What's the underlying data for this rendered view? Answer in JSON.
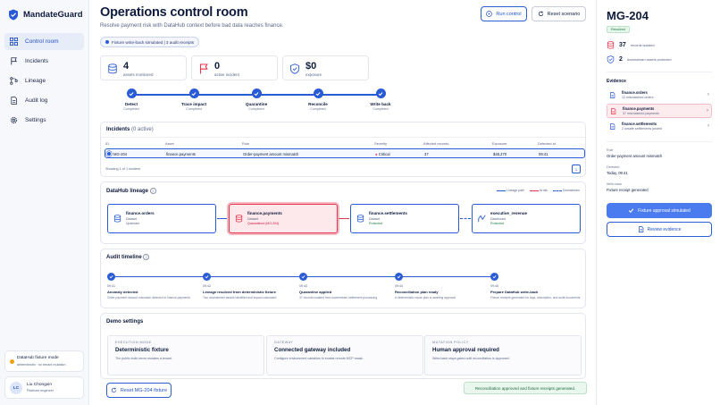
{
  "app": {
    "name": "MandateGuard"
  },
  "sidebar": {
    "items": [
      {
        "label": "Control room",
        "icon": "grid-icon"
      },
      {
        "label": "Incidents",
        "icon": "flag-icon"
      },
      {
        "label": "Lineage",
        "icon": "branch-icon"
      },
      {
        "label": "Audit log",
        "icon": "document-icon"
      },
      {
        "label": "Settings",
        "icon": "gear-icon"
      }
    ],
    "mode_card": {
      "title": "DataHub fixture mode",
      "desc": "deterministic · no tenant mutation"
    },
    "user": {
      "initials": "LC",
      "name": "Liu Chongxin",
      "role": "Platform engineer"
    }
  },
  "header": {
    "title": "Operations control room",
    "subtitle": "Resolve payment risk with DataHub context before bad data reaches finance.",
    "pill": "Fixture write-back simulated | 3 audit receipts",
    "run_label": "Run control",
    "reset_label": "Reset scenario"
  },
  "stats": [
    {
      "num": "4",
      "label": "assets monitored",
      "icon": "database-icon"
    },
    {
      "num": "0",
      "label": "active incident",
      "icon": "flag-icon"
    },
    {
      "num": "$0",
      "label": "exposure",
      "icon": "shield-icon"
    }
  ],
  "steps": [
    {
      "title": "Detect",
      "status": "Completed"
    },
    {
      "title": "Trace impact",
      "status": "Completed"
    },
    {
      "title": "Quarantine",
      "status": "Completed"
    },
    {
      "title": "Reconcile",
      "status": "Completed"
    },
    {
      "title": "Write back",
      "status": "Completed"
    }
  ],
  "incidents": {
    "title": "Incidents",
    "count": "(0 active)",
    "columns": [
      "ID",
      "Asset",
      "Rule",
      "Severity",
      "Affected records",
      "Exposure",
      "Detected at"
    ],
    "rows": [
      {
        "id": "MG-204",
        "asset": "finance.payments",
        "rule": "Order-payment amount mismatch",
        "severity": "Critical",
        "affected": "37",
        "exposure": "$48,270",
        "detected": "09:41"
      }
    ],
    "footer": "Showing 1 of 1 incident",
    "page": "1"
  },
  "lineage": {
    "title": "DataHub lineage",
    "legend": [
      "Lineage path",
      "At risk",
      "Downstream"
    ],
    "nodes": [
      {
        "name": "finance.orders",
        "type": "Dataset",
        "status": "Upstream"
      },
      {
        "name": "finance.payments",
        "type": "Dataset",
        "status": "Quarantined (MG-204)"
      },
      {
        "name": "finance.settlements",
        "type": "Dataset",
        "status": "Protected"
      },
      {
        "name": "executive_revenue",
        "type": "Dashboard",
        "status": "Protected"
      }
    ]
  },
  "timeline": {
    "title": "Audit timeline",
    "items": [
      {
        "time": "09:41",
        "title": "Anomaly detected",
        "desc": "Order-payment amount mismatch detected in finance.payments"
      },
      {
        "time": "09:42",
        "title": "Lineage resolved from deterministic fixture",
        "desc": "Two downstream assets identified and impact calculated"
      },
      {
        "time": "09:43",
        "title": "Quarantine applied",
        "desc": "37 records isolated from downstream settlement processing"
      },
      {
        "time": "09:44",
        "title": "Reconciliation plan ready",
        "desc": "A deterministic repair plan is awaiting approval"
      },
      {
        "time": "09:45",
        "title": "Prepare DataHub write-back",
        "desc": "Fixture receipts generated for tags, description, and audit documents"
      }
    ]
  },
  "demo": {
    "title": "Demo settings",
    "cards": [
      {
        "key": "EXECUTION MODE",
        "value": "Deterministic fixture",
        "desc": "The public build never mutates a tenant."
      },
      {
        "key": "GATEWAY",
        "value": "Connected gateway included",
        "desc": "Configure environment variables to enable remote MCP reads."
      },
      {
        "key": "MUTATION POLICY",
        "value": "Human approval required",
        "desc": "Write-back stays gated until reconciliation is approved."
      }
    ]
  },
  "reset_fixture_label": "Reset MG-204 fixture",
  "toast": "Reconciliation approved and fixture receipts generated.",
  "detail": {
    "id": "MG-204",
    "badge": "Resolved",
    "metrics": [
      {
        "num": "37",
        "label": "records isolated",
        "icon": "database-icon"
      },
      {
        "num": "2",
        "label": "downstream assets protected",
        "icon": "shield-icon"
      }
    ],
    "evidence_title": "Evidence",
    "evidence": [
      {
        "title": "finance.orders",
        "sub": "12 mismatched orders"
      },
      {
        "title": "finance.payments",
        "sub": "37 mismatched payments"
      },
      {
        "title": "finance.settlements",
        "sub": "2 unsafe settlements posted"
      }
    ],
    "rule_key": "Rule",
    "rule": "Order-payment amount mismatch",
    "detected_key": "Detected",
    "detected": "Today, 09:41",
    "wb_key": "Write-back",
    "wb": "Fixture receipt generated",
    "approve_label": "Fixture approval simulated",
    "review_label": "Review evidence"
  },
  "colors": {
    "accent": "#2a5bd7",
    "critical": "#e5374f",
    "success": "#1e7a40"
  }
}
